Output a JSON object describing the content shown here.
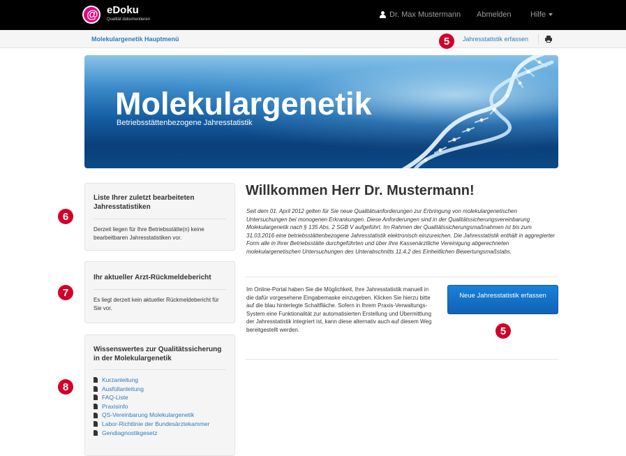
{
  "brand": {
    "logo_letter": "@",
    "name": "eDoku",
    "tagline": "Qualität dokumentieren"
  },
  "topnav": {
    "user": "Dr. Max Mustermann",
    "logout": "Abmelden",
    "help": "Hilfe"
  },
  "subnav": {
    "home": "Molekulargenetik Hauptmenü",
    "action": "Jahresstatistik erfassen"
  },
  "banner": {
    "title": "Molekulargenetik",
    "subtitle": "Betriebsstättenbezogene Jahresstatistik"
  },
  "badges": {
    "b5": "5",
    "b6": "6",
    "b7": "7",
    "b8": "8"
  },
  "panels": {
    "recent": {
      "title": "Liste Ihrer zuletzt bearbeiteten Jahresstatistiken",
      "text": "Derzeit liegen für Ihre Betriebsstätte(n) keine bearbeitbaren Jahresstatistiken vor."
    },
    "report": {
      "title": "Ihr aktueller Arzt-Rückmeldebericht",
      "text": "Es liegt derzeit kein aktueller Rückmeldebericht für Sie vor."
    },
    "info": {
      "title": "Wissenswertes zur Qualitätssicherung in der Molekulargenetik",
      "links": [
        "Kurzanleitung",
        "Ausfüllanleitung",
        "FAQ-Liste",
        "Praxisinfo",
        "QS-Vereinbarung Molekulargenetik",
        "Labor-Richtlinie der Bundesärztekammer",
        "Gendiagnostikgesetz"
      ]
    }
  },
  "main": {
    "welcome": "Willkommen Herr Dr. Mustermann!",
    "intro": "Seit dem 01. April 2012 gelten für Sie neue Qualitätsanforderungen zur Erbringung von molekulargenetischen Untersuchungen bei monogenen Erkrankungen. Diese Anforderungen sind in der Qualitätssicherungsvereinbarung Molekulargenetik nach § 135 Abs. 2 SGB V aufgeführt. Im Rahmen der Qualitätssicherungsmaßnahmen ist bis zum 31.03.2016 eine betriebsstättenbezogene Jahresstatistik elektronisch einzureichen. Die Jahresstatistik enthält in aggregierter Form alle in Ihrer Betriebsstätte durchgeführten und über Ihre Kassenärztliche Vereinigung abgerechneten molekulargenetischen Untersuchungen des Unterabschnitts 11.4.2 des Einheitlichen Bewertungsmaßstabs.",
    "portal": "Im Online-Portal haben Sie die Möglichkeit, Ihre Jahresstatistik manuell in die dafür vorgesehene Eingabemaske einzugeben. Klicken Sie hierzu bitte auf die blau hinterlegte Schaltfläche. Sofern in Ihrem Praxis-Verwaltungs-System eine Funktionalität zur automatisierten Erstellung und Übermittlung der Jahresstatistik integriert ist, kann diese alternativ auch auf diesem Weg bereitgestellt werden.",
    "new_button": "Neue Jahresstatistik erfassen"
  },
  "colors": {
    "accent": "#337ab7",
    "badge": "#d1002a",
    "brand": "#e3007d",
    "button": "#1a82d9"
  }
}
